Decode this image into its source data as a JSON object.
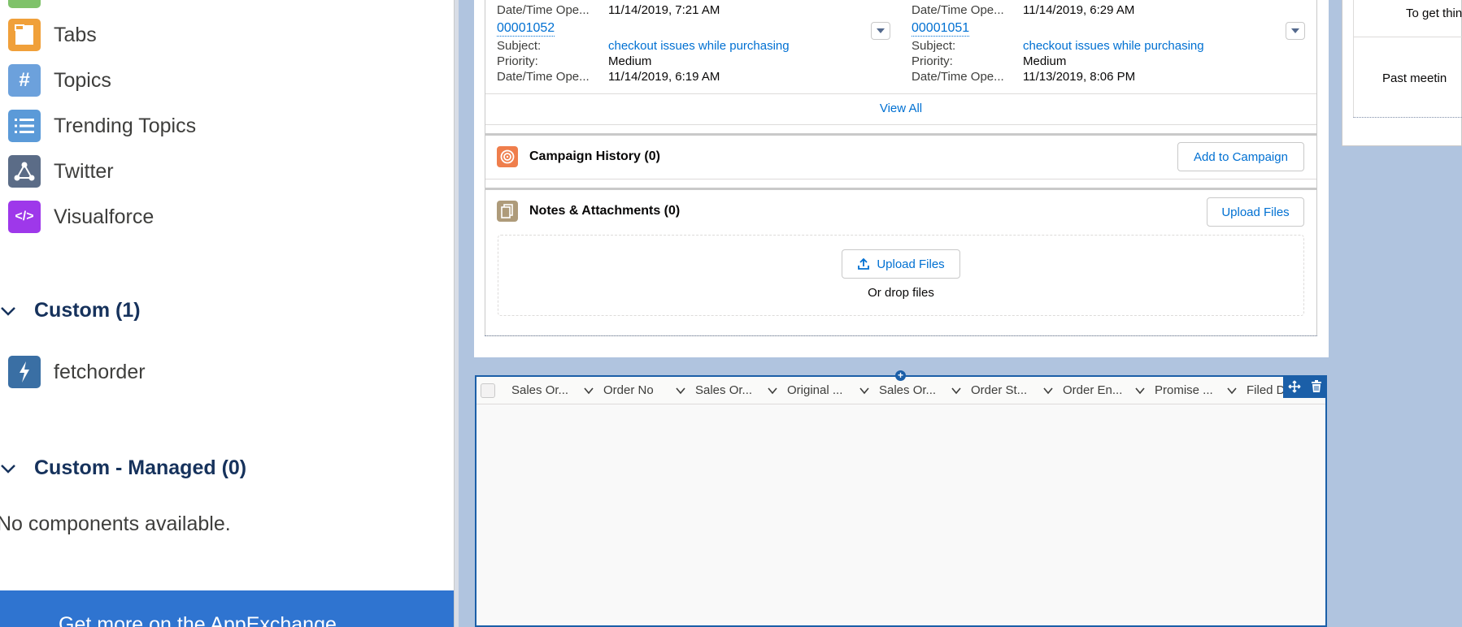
{
  "left_panel": {
    "standard_items": [
      {
        "label": "Tabs",
        "icon": "tabs-icon",
        "color": "#f0a03a"
      },
      {
        "label": "Topics",
        "icon": "hash-icon",
        "color": "#6ca1dc"
      },
      {
        "label": "Trending Topics",
        "icon": "list-icon",
        "color": "#5b9ad8"
      },
      {
        "label": "Twitter",
        "icon": "twitter-icon",
        "color": "#5b6c87"
      },
      {
        "label": "Visualforce",
        "icon": "code-icon",
        "color": "#9e38ea"
      }
    ],
    "custom_section": {
      "title": "Custom (1)",
      "items": [
        {
          "label": "fetchorder",
          "icon": "lightning-icon",
          "color": "#3a6fa4"
        }
      ]
    },
    "managed_section": {
      "title": "Custom - Managed (0)",
      "empty_text": "No components available."
    },
    "appexchange_label": "Get more on the AppExchange"
  },
  "cases": {
    "partial_left": {
      "label": "Date/Time Ope...",
      "value": "11/14/2019, 7:21 AM"
    },
    "partial_right": {
      "label": "Date/Time Ope...",
      "value": "11/14/2019, 6:29 AM"
    },
    "records": [
      {
        "number": "00001052",
        "subject_label": "Subject:",
        "subject": "checkout issues while purchasing",
        "priority_label": "Priority:",
        "priority": "Medium",
        "date_label": "Date/Time Ope...",
        "date": "11/14/2019, 6:19 AM"
      },
      {
        "number": "00001051",
        "subject_label": "Subject:",
        "subject": "checkout issues while purchasing",
        "priority_label": "Priority:",
        "priority": "Medium",
        "date_label": "Date/Time Ope...",
        "date": "11/13/2019, 8:06 PM"
      }
    ],
    "view_all": "View All"
  },
  "campaign": {
    "title": "Campaign History (0)",
    "button": "Add to Campaign",
    "icon": "target-icon",
    "color": "#ef7e4c"
  },
  "notes": {
    "title": "Notes & Attachments (0)",
    "button": "Upload Files",
    "icon": "file-icon",
    "color": "#ae9b7a",
    "upload_button": "Upload Files",
    "drop_text": "Or drop files"
  },
  "table": {
    "columns": [
      "Sales Or...",
      "Order No",
      "Sales Or...",
      "Original ...",
      "Sales Or...",
      "Order St...",
      "Order En...",
      "Promise ...",
      "Filed D"
    ]
  },
  "right_panel": {
    "line1": "To get thin",
    "line2": "Past meetin"
  }
}
